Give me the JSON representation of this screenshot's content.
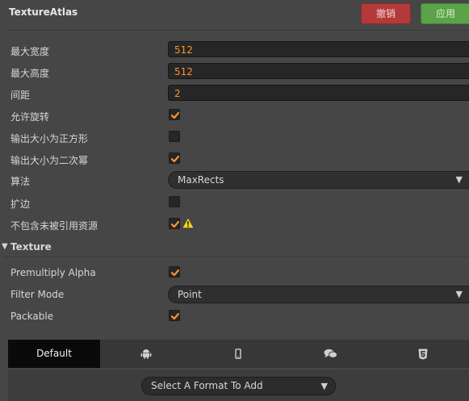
{
  "header": {
    "title": "TextureAtlas",
    "revert_label": "撤销",
    "apply_label": "应用"
  },
  "fields": {
    "max_width": {
      "label": "最大宽度",
      "value": "512"
    },
    "max_height": {
      "label": "最大高度",
      "value": "512"
    },
    "padding": {
      "label": "间距",
      "value": "2"
    },
    "allow_rotation": {
      "label": "允许旋转",
      "checked": true
    },
    "force_squared": {
      "label": "输出大小为正方形",
      "checked": false
    },
    "power_of_two": {
      "label": "输出大小为二次幂",
      "checked": true
    },
    "algorithm": {
      "label": "算法",
      "value": "MaxRects"
    },
    "extrude": {
      "label": "扩边",
      "checked": false
    },
    "filter_unused": {
      "label": "不包含未被引用资源",
      "checked": true
    }
  },
  "texture": {
    "section_label": "Texture",
    "premultiply_alpha": {
      "label": "Premultiply Alpha",
      "checked": true
    },
    "filter_mode": {
      "label": "Filter Mode",
      "value": "Point"
    },
    "packable": {
      "label": "Packable",
      "checked": true
    }
  },
  "platform_tabs": [
    {
      "label": "Default",
      "icon": null
    },
    {
      "label": "",
      "icon": "android-icon"
    },
    {
      "label": "",
      "icon": "mobile-phone-icon"
    },
    {
      "label": "",
      "icon": "chat-icon"
    },
    {
      "label": "",
      "icon": "html5-icon"
    }
  ],
  "format_select": {
    "placeholder": "Select A Format To Add"
  },
  "colors": {
    "accent": "#fd942b",
    "warning": "#f5d51a",
    "revert": "#b3393a",
    "apply": "#5aa349"
  }
}
